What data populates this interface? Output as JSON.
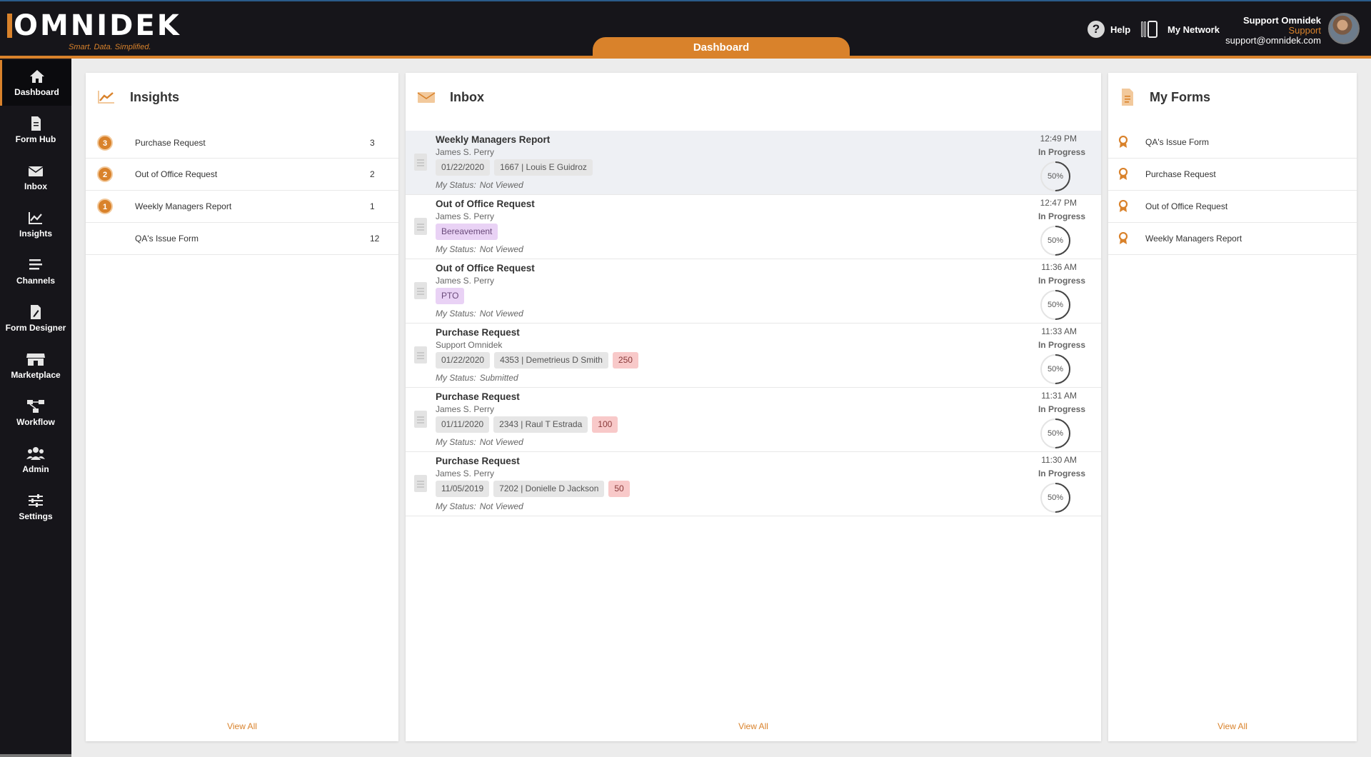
{
  "header": {
    "logo_text": "OMNIDEK",
    "tagline": "Smart. Data. Simplified.",
    "active_tab": "Dashboard",
    "help_label": "Help",
    "network_label": "My Network",
    "user": {
      "name": "Support Omnidek",
      "role": "Support",
      "email": "support@omnidek.com"
    }
  },
  "sidebar": {
    "items": [
      {
        "label": "Dashboard",
        "icon": "home-icon",
        "active": true
      },
      {
        "label": "Form Hub",
        "icon": "document-icon"
      },
      {
        "label": "Inbox",
        "icon": "envelope-icon"
      },
      {
        "label": "Insights",
        "icon": "chart-icon"
      },
      {
        "label": "Channels",
        "icon": "menu-icon"
      },
      {
        "label": "Form Designer",
        "icon": "form-edit-icon"
      },
      {
        "label": "Marketplace",
        "icon": "store-icon"
      },
      {
        "label": "Workflow",
        "icon": "workflow-icon"
      },
      {
        "label": "Admin",
        "icon": "users-icon"
      },
      {
        "label": "Settings",
        "icon": "sliders-icon"
      }
    ]
  },
  "insights": {
    "title": "Insights",
    "rows": [
      {
        "badge": "3",
        "label": "Purchase Request",
        "count": "3"
      },
      {
        "badge": "2",
        "label": "Out of Office Request",
        "count": "2"
      },
      {
        "badge": "1",
        "label": "Weekly Managers Report",
        "count": "1"
      },
      {
        "badge": "",
        "label": "QA's Issue Form",
        "count": "12"
      }
    ],
    "view_all": "View All"
  },
  "inbox": {
    "title": "Inbox",
    "rows": [
      {
        "title": "Weekly Managers Report",
        "sender": "James S. Perry",
        "tags": [
          {
            "text": "01/22/2020",
            "kind": "grey"
          },
          {
            "text": "1667 | Louis E Guidroz",
            "kind": "grey"
          }
        ],
        "status_label": "My Status:",
        "status": "Not Viewed",
        "time": "12:49 PM",
        "state": "In Progress",
        "progress": 0.5,
        "progress_text": "50%"
      },
      {
        "title": "Out of Office Request",
        "sender": "James S. Perry",
        "tags": [
          {
            "text": "Bereavement",
            "kind": "purple"
          }
        ],
        "status_label": "My Status:",
        "status": "Not Viewed",
        "time": "12:47 PM",
        "state": "In Progress",
        "progress": 0.5,
        "progress_text": "50%"
      },
      {
        "title": "Out of Office Request",
        "sender": "James S. Perry",
        "tags": [
          {
            "text": "PTO",
            "kind": "purple"
          }
        ],
        "status_label": "My Status:",
        "status": "Not Viewed",
        "time": "11:36 AM",
        "state": "In Progress",
        "progress": 0.5,
        "progress_text": "50%"
      },
      {
        "title": "Purchase Request",
        "sender": "Support Omnidek",
        "tags": [
          {
            "text": "01/22/2020",
            "kind": "grey"
          },
          {
            "text": "4353 | Demetrieus D Smith",
            "kind": "grey"
          },
          {
            "text": "250",
            "kind": "red"
          }
        ],
        "status_label": "My Status:",
        "status": "Submitted",
        "time": "11:33 AM",
        "state": "In Progress",
        "progress": 0.5,
        "progress_text": "50%"
      },
      {
        "title": "Purchase Request",
        "sender": "James S. Perry",
        "tags": [
          {
            "text": "01/11/2020",
            "kind": "grey"
          },
          {
            "text": "2343 | Raul T Estrada",
            "kind": "grey"
          },
          {
            "text": "100",
            "kind": "red"
          }
        ],
        "status_label": "My Status:",
        "status": "Not Viewed",
        "time": "11:31 AM",
        "state": "In Progress",
        "progress": 0.5,
        "progress_text": "50%"
      },
      {
        "title": "Purchase Request",
        "sender": "James S. Perry",
        "tags": [
          {
            "text": "11/05/2019",
            "kind": "grey"
          },
          {
            "text": "7202 | Donielle D Jackson",
            "kind": "grey"
          },
          {
            "text": "50",
            "kind": "red"
          }
        ],
        "status_label": "My Status:",
        "status": "Not Viewed",
        "time": "11:30 AM",
        "state": "In Progress",
        "progress": 0.5,
        "progress_text": "50%"
      }
    ],
    "view_all": "View All"
  },
  "my_forms": {
    "title": "My Forms",
    "rows": [
      {
        "label": "QA's Issue Form"
      },
      {
        "label": "Purchase Request"
      },
      {
        "label": "Out of Office Request"
      },
      {
        "label": "Weekly Managers Report"
      }
    ],
    "view_all": "View All"
  },
  "colors": {
    "accent": "#d9822b",
    "header_bg": "#16151a",
    "highlight_row": "#eef0f4"
  }
}
